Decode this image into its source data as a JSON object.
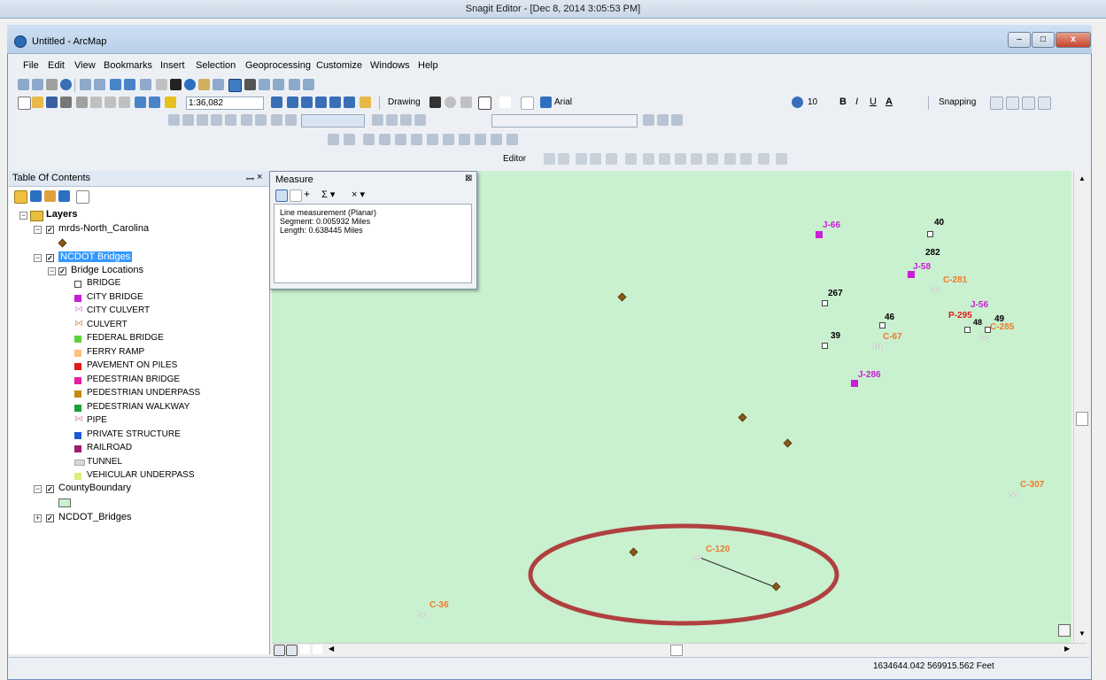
{
  "snagit": {
    "title": "Snagit Editor - [Dec 8, 2014 3:05:53 PM]"
  },
  "app": {
    "title": "Untitled - ArcMap"
  },
  "menu": [
    "File",
    "Edit",
    "View",
    "Bookmarks",
    "Insert",
    "Selection",
    "Geoprocessing",
    "Customize",
    "Windows",
    "Help"
  ],
  "toolbar": {
    "scale": "1:36,082",
    "drawing_label": "Drawing",
    "font_name": "Arial",
    "font_size": "10",
    "bold": "B",
    "italic": "I",
    "underline": "U",
    "font_color": "A",
    "snapping_label": "Snapping",
    "editor_label": "Editor"
  },
  "toc": {
    "title": "Table Of Contents",
    "pin": "‑Ϊ",
    "close": "×",
    "layers_label": "Layers",
    "mrds_layer": "mrds-North_Carolina",
    "ncdot_layer": "NCDOT Bridges",
    "bridge_locations": "Bridge Locations",
    "legend": [
      {
        "label": "BRIDGE",
        "color": "#ffffff",
        "shape": "square-dot"
      },
      {
        "label": "CITY BRIDGE",
        "color": "#c81ed6",
        "shape": "square"
      },
      {
        "label": "CITY CULVERT",
        "color": "#e8a0e8",
        "shape": "culvert"
      },
      {
        "label": "CULVERT",
        "color": "#e0a070",
        "shape": "culvert"
      },
      {
        "label": "FEDERAL BRIDGE",
        "color": "#5cd33a",
        "shape": "square"
      },
      {
        "label": "FERRY RAMP",
        "color": "#ffc07a",
        "shape": "square"
      },
      {
        "label": "PAVEMENT ON PILES",
        "color": "#e01a1a",
        "shape": "square"
      },
      {
        "label": "PEDESTRIAN BRIDGE",
        "color": "#e81ea0",
        "shape": "square"
      },
      {
        "label": "PEDESTRIAN UNDERPASS",
        "color": "#c88a12",
        "shape": "square"
      },
      {
        "label": "PEDESTRIAN WALKWAY",
        "color": "#1e9e3a",
        "shape": "square"
      },
      {
        "label": "PIPE",
        "color": "#e8a0a0",
        "shape": "culvert"
      },
      {
        "label": "PRIVATE STRUCTURE",
        "color": "#1e5ad6",
        "shape": "square"
      },
      {
        "label": "RAILROAD",
        "color": "#9e1a70",
        "shape": "square"
      },
      {
        "label": "TUNNEL",
        "color": "#d8d8d8",
        "shape": "tunnel"
      },
      {
        "label": "VEHICULAR UNDERPASS",
        "color": "#d8f07a",
        "shape": "square"
      }
    ],
    "county_layer": "CountyBoundary",
    "ncdot_bridges2": "NCDOT_Bridges"
  },
  "measure": {
    "title": "Measure",
    "close": "⊠",
    "line1": "Line measurement (Planar)",
    "line2": "Segment: 0.005932 Miles",
    "line3": "Length: 0.638445 Miles"
  },
  "map_labels": [
    {
      "text": "J-66",
      "color": "#c81ed6"
    },
    {
      "text": "40",
      "color": "#000000"
    },
    {
      "text": "282",
      "color": "#000000"
    },
    {
      "text": "J-58",
      "color": "#c81ed6"
    },
    {
      "text": "C-281",
      "color": "#f07a2a"
    },
    {
      "text": "267",
      "color": "#000000"
    },
    {
      "text": "J-56",
      "color": "#c81ed6"
    },
    {
      "text": "46",
      "color": "#000000"
    },
    {
      "text": "P-295",
      "color": "#e01a1a"
    },
    {
      "text": "48",
      "color": "#000000"
    },
    {
      "text": "49",
      "color": "#000000"
    },
    {
      "text": "C-285",
      "color": "#f07a2a"
    },
    {
      "text": "C-67",
      "color": "#f07a2a"
    },
    {
      "text": "39",
      "color": "#000000"
    },
    {
      "text": "J-286",
      "color": "#c81ed6"
    },
    {
      "text": "C-307",
      "color": "#f07a2a"
    },
    {
      "text": "C-120",
      "color": "#f07a2a"
    },
    {
      "text": "C-36",
      "color": "#f07a2a"
    }
  ],
  "status": {
    "coordinates": "1634644.042  569915.562 Feet"
  },
  "colors": {
    "map_bg": "#c9f0cf",
    "ellipse": "#b04040"
  }
}
